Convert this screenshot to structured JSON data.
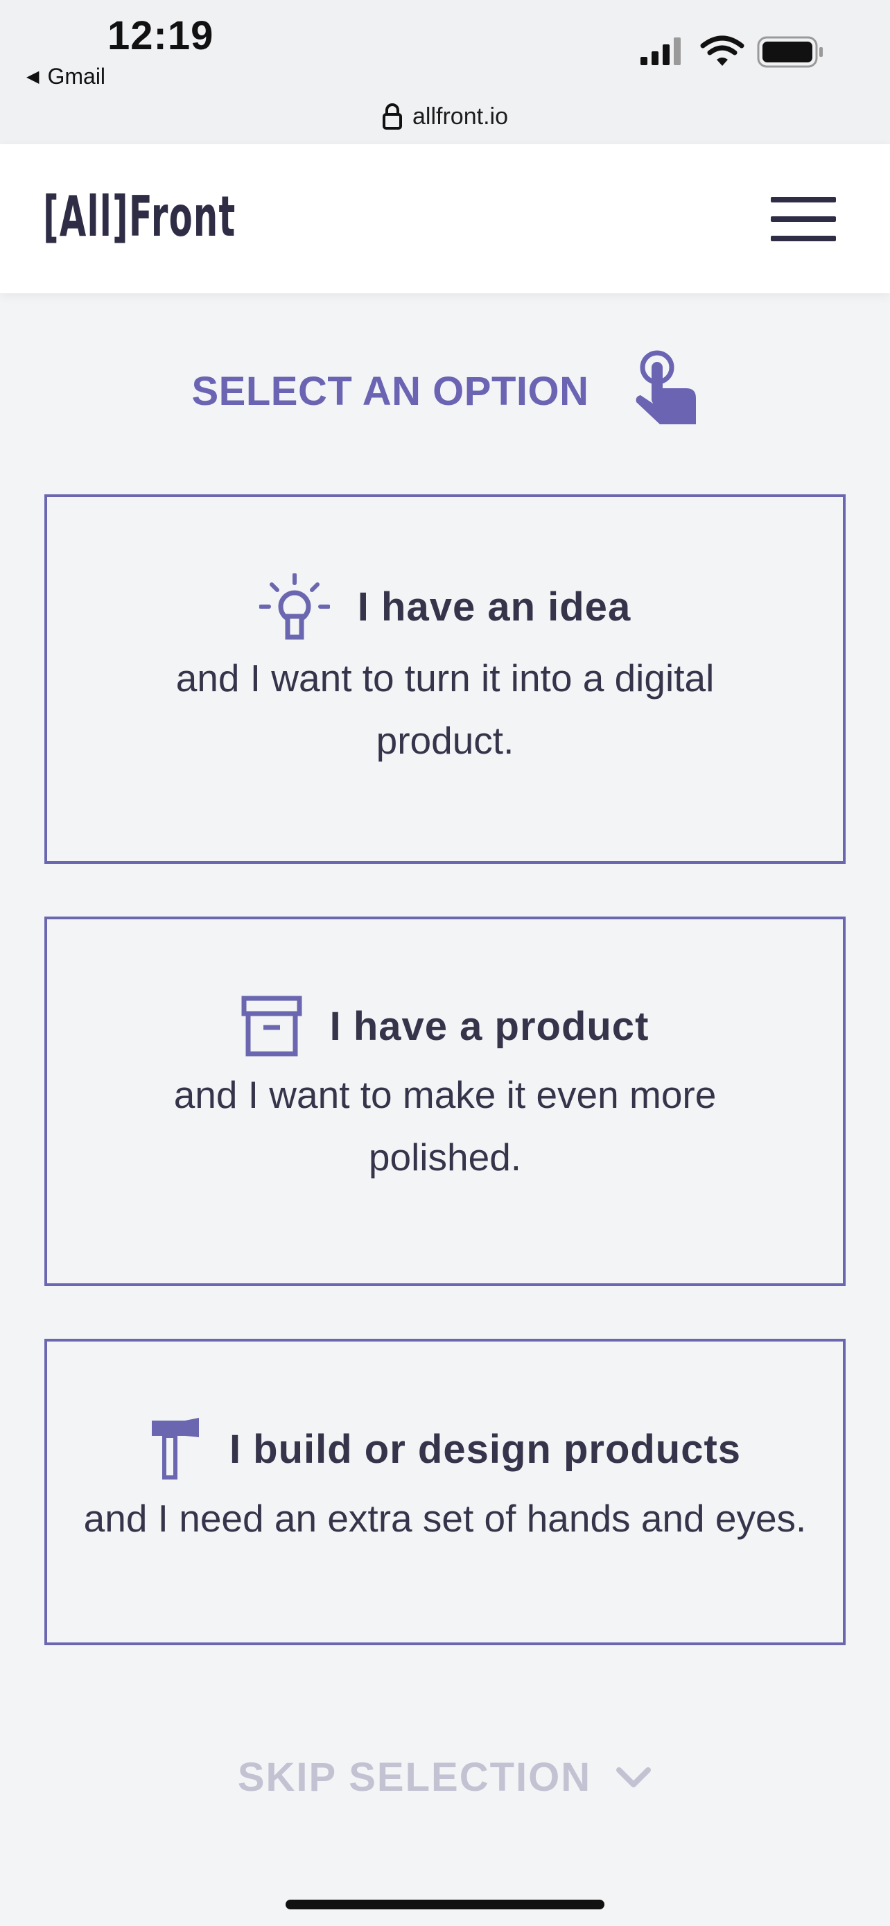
{
  "status_bar": {
    "time": "12:19",
    "back_app": "Gmail",
    "url": "allfront.io",
    "icons": [
      "signal-icon",
      "wifi-icon",
      "battery-icon",
      "lock-icon"
    ]
  },
  "header": {
    "logo": "[All]Front",
    "menu_icon": "hamburger-menu-icon"
  },
  "heading": {
    "title": "SELECT AN OPTION",
    "icon": "pointer-hand-icon"
  },
  "options": [
    {
      "icon": "lightbulb-icon",
      "title": "I have an idea",
      "line1": "and I want to turn it into a digital",
      "line2": "product."
    },
    {
      "icon": "archive-box-icon",
      "title": "I have a product",
      "line1": "and I want to make it even more",
      "line2": "polished."
    },
    {
      "icon": "hammer-icon",
      "title": "I build or design products",
      "line1": "and I need an extra set of hands and eyes."
    }
  ],
  "skip": {
    "label": "SKIP SELECTION",
    "icon": "chevron-down-icon"
  },
  "colors": {
    "accent": "#6b66b0",
    "text": "#35344a",
    "muted": "#c3c2d2",
    "background": "#f3f4f6"
  }
}
